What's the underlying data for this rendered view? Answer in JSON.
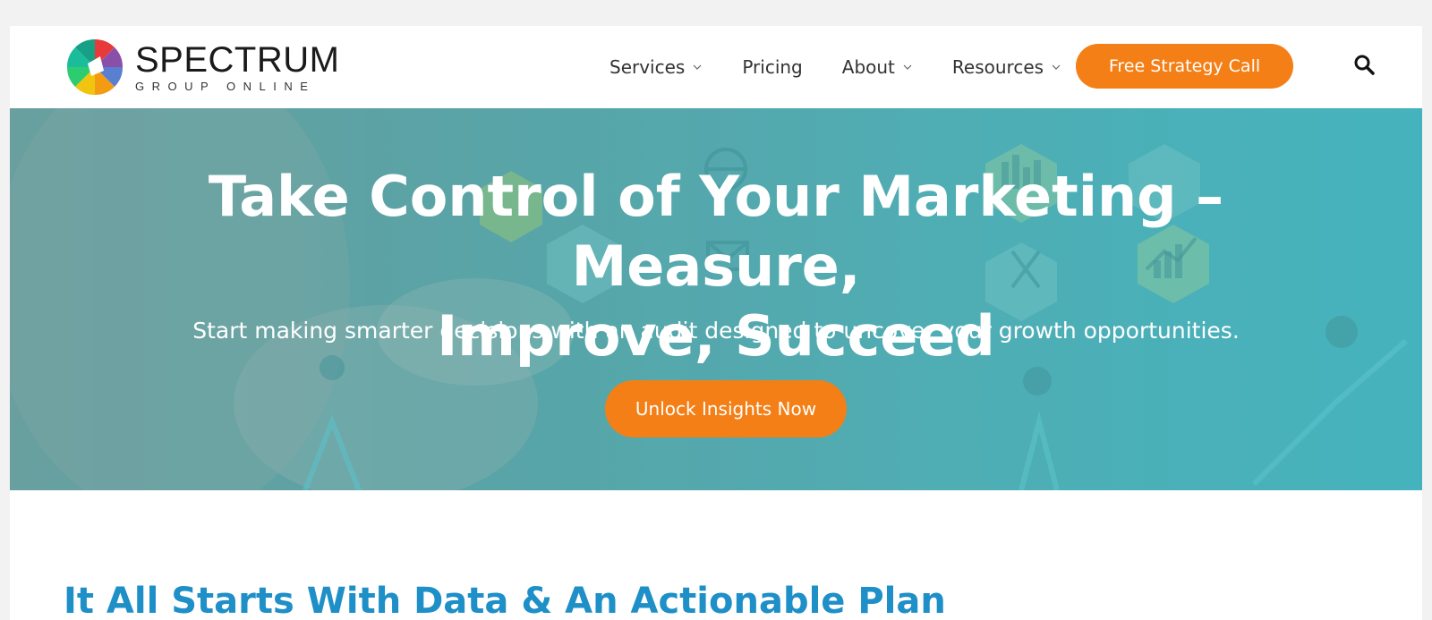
{
  "brand": {
    "name": "SPECTRUM",
    "tagline": "GROUP ONLINE"
  },
  "nav": {
    "items": [
      {
        "label": "Services",
        "has_dropdown": true
      },
      {
        "label": "Pricing",
        "has_dropdown": false
      },
      {
        "label": "About",
        "has_dropdown": true
      },
      {
        "label": "Resources",
        "has_dropdown": true
      }
    ],
    "cta_label": "Free Strategy Call",
    "search_icon": "search-icon"
  },
  "hero": {
    "title_line1": "Take Control of Your Marketing – Measure,",
    "title_line2": "Improve, Succeed",
    "subtitle": "Start making smarter decisions with an audit designed to uncover your growth opportunities.",
    "cta_label": "Unlock Insights Now"
  },
  "section": {
    "title": "It All Starts With Data & An Actionable Plan"
  },
  "colors": {
    "accent": "#f47f16",
    "heading_blue": "#1e8fc7",
    "hero_teal": "#4fb0b7"
  }
}
